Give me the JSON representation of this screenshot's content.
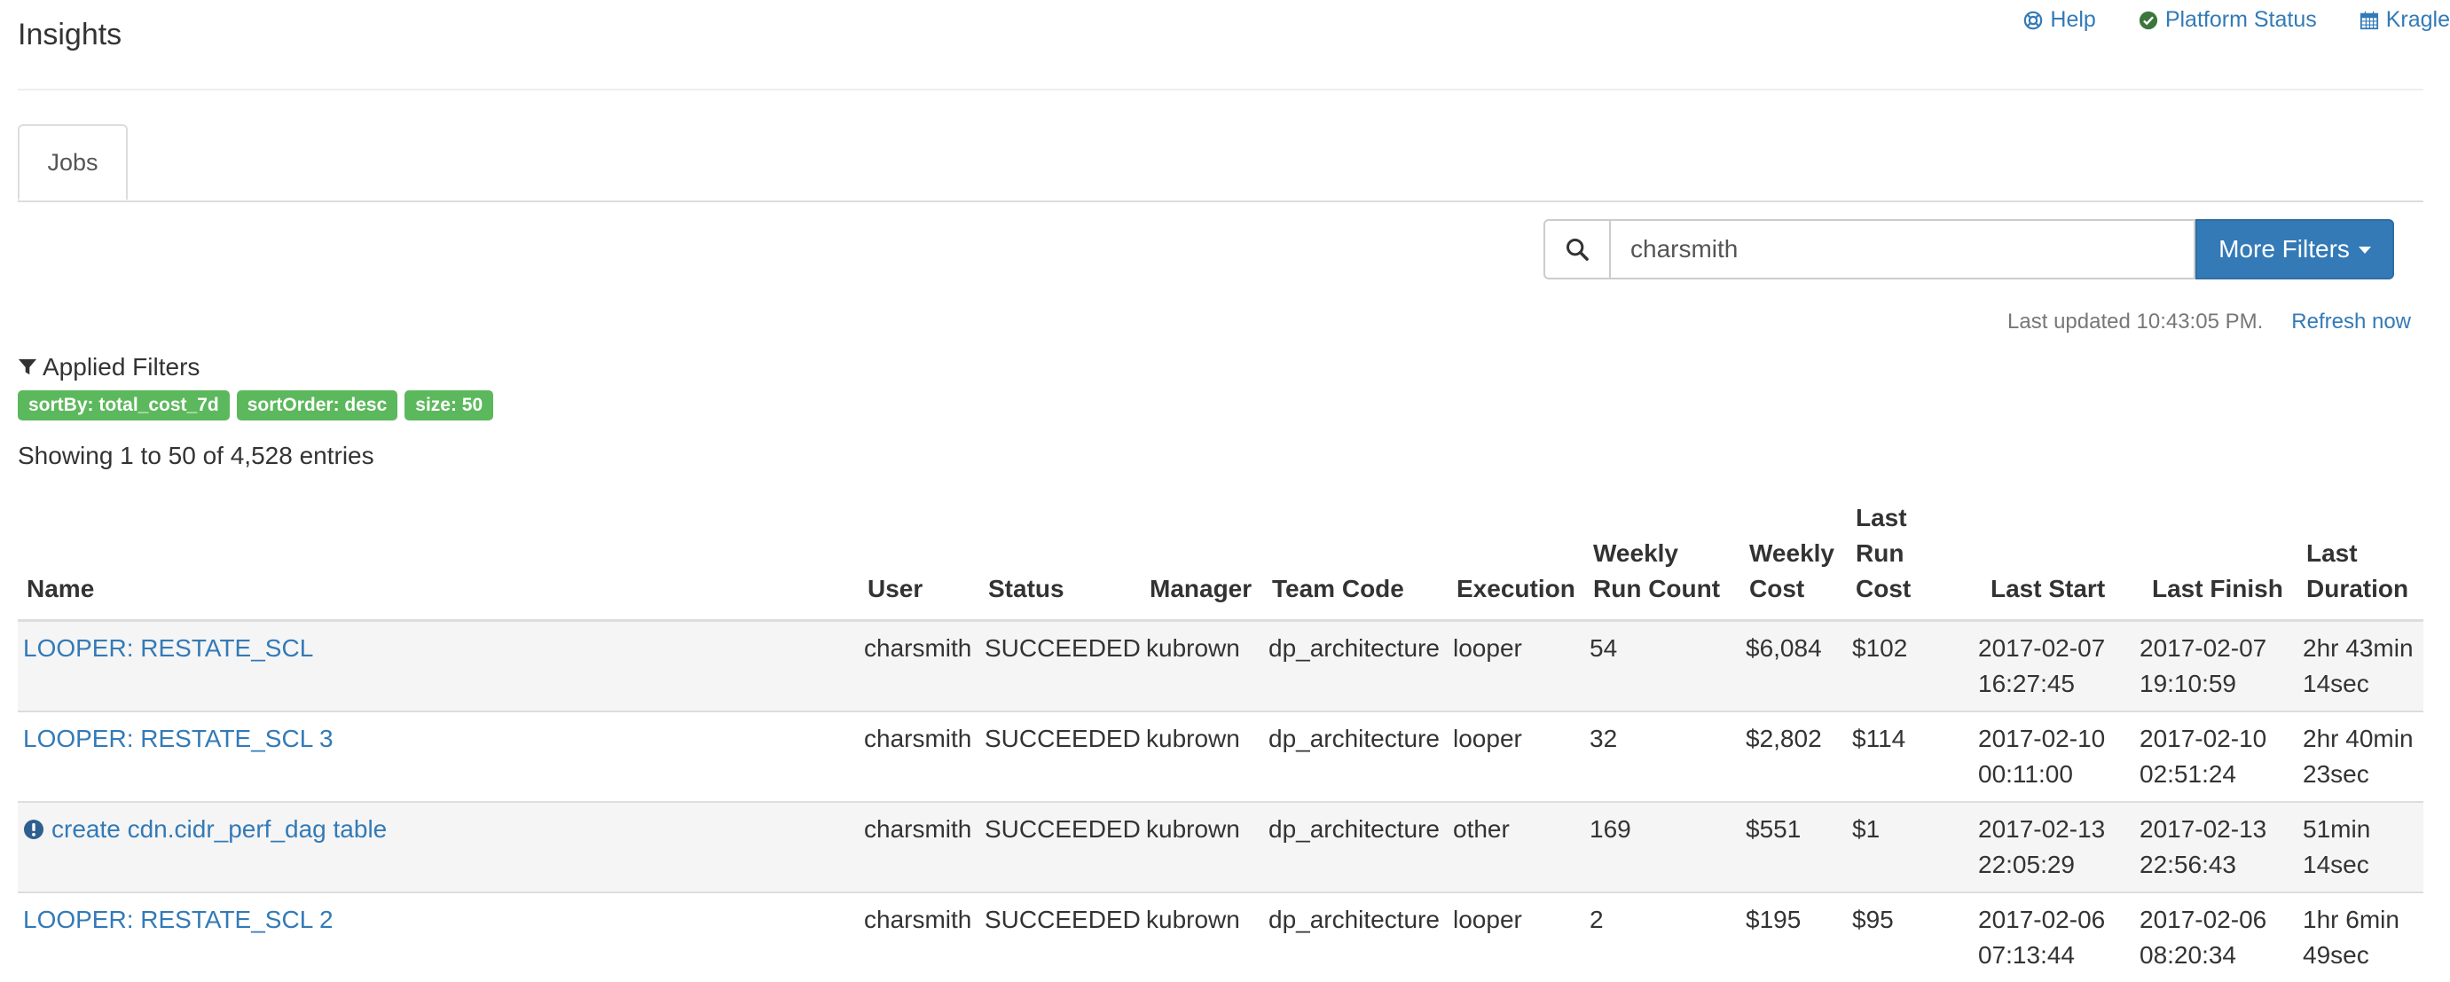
{
  "page_title": "Insights",
  "top_links": [
    {
      "label": "Help",
      "icon": "life-ring-icon"
    },
    {
      "label": "Platform Status",
      "icon": "check-circle-icon"
    },
    {
      "label": "Kragle",
      "icon": "calendar-icon"
    }
  ],
  "tabs": [
    {
      "label": "Jobs",
      "active": true
    }
  ],
  "search": {
    "value": "charsmith",
    "placeholder": ""
  },
  "more_filters_label": "More Filters",
  "last_updated": "Last updated 10:43:05 PM.",
  "refresh_label": "Refresh now",
  "applied_filters_label": "Applied Filters",
  "filters": [
    "sortBy: total_cost_7d",
    "sortOrder: desc",
    "size: 50"
  ],
  "showing_text": "Showing 1 to 50 of 4,528 entries",
  "table": {
    "columns": [
      "Name",
      "User",
      "Status",
      "Manager",
      "Team Code",
      "Execution",
      "Weekly Run Count",
      "Weekly Cost",
      "Last Run Cost",
      "Last Start",
      "Last Finish",
      "Last Duration"
    ],
    "rows": [
      {
        "name": "LOOPER: RESTATE_SCL",
        "warning": false,
        "user": "charsmith",
        "status": "SUCCEEDED",
        "manager": "kubrown",
        "team_code": "dp_architecture",
        "execution": "looper",
        "weekly_run_count": "54",
        "weekly_cost": "$6,084",
        "last_run_cost": "$102",
        "last_start": "2017-02-07 16:27:45",
        "last_finish": "2017-02-07 19:10:59",
        "last_duration": "2hr 43min 14sec"
      },
      {
        "name": "LOOPER: RESTATE_SCL 3",
        "warning": false,
        "user": "charsmith",
        "status": "SUCCEEDED",
        "manager": "kubrown",
        "team_code": "dp_architecture",
        "execution": "looper",
        "weekly_run_count": "32",
        "weekly_cost": "$2,802",
        "last_run_cost": "$114",
        "last_start": "2017-02-10 00:11:00",
        "last_finish": "2017-02-10 02:51:24",
        "last_duration": "2hr 40min 23sec"
      },
      {
        "name": "create cdn.cidr_perf_dag table",
        "warning": true,
        "user": "charsmith",
        "status": "SUCCEEDED",
        "manager": "kubrown",
        "team_code": "dp_architecture",
        "execution": "other",
        "weekly_run_count": "169",
        "weekly_cost": "$551",
        "last_run_cost": "$1",
        "last_start": "2017-02-13 22:05:29",
        "last_finish": "2017-02-13 22:56:43",
        "last_duration": "51min 14sec"
      },
      {
        "name": "LOOPER: RESTATE_SCL 2",
        "warning": false,
        "user": "charsmith",
        "status": "SUCCEEDED",
        "manager": "kubrown",
        "team_code": "dp_architecture",
        "execution": "looper",
        "weekly_run_count": "2",
        "weekly_cost": "$195",
        "last_run_cost": "$95",
        "last_start": "2017-02-06 07:13:44",
        "last_finish": "2017-02-06 08:20:34",
        "last_duration": "1hr 6min 49sec"
      }
    ]
  },
  "colors": {
    "link": "#337ab7",
    "primary_button": "#337ab7",
    "badge": "#5cb85c",
    "stripe": "#f5f5f5"
  }
}
